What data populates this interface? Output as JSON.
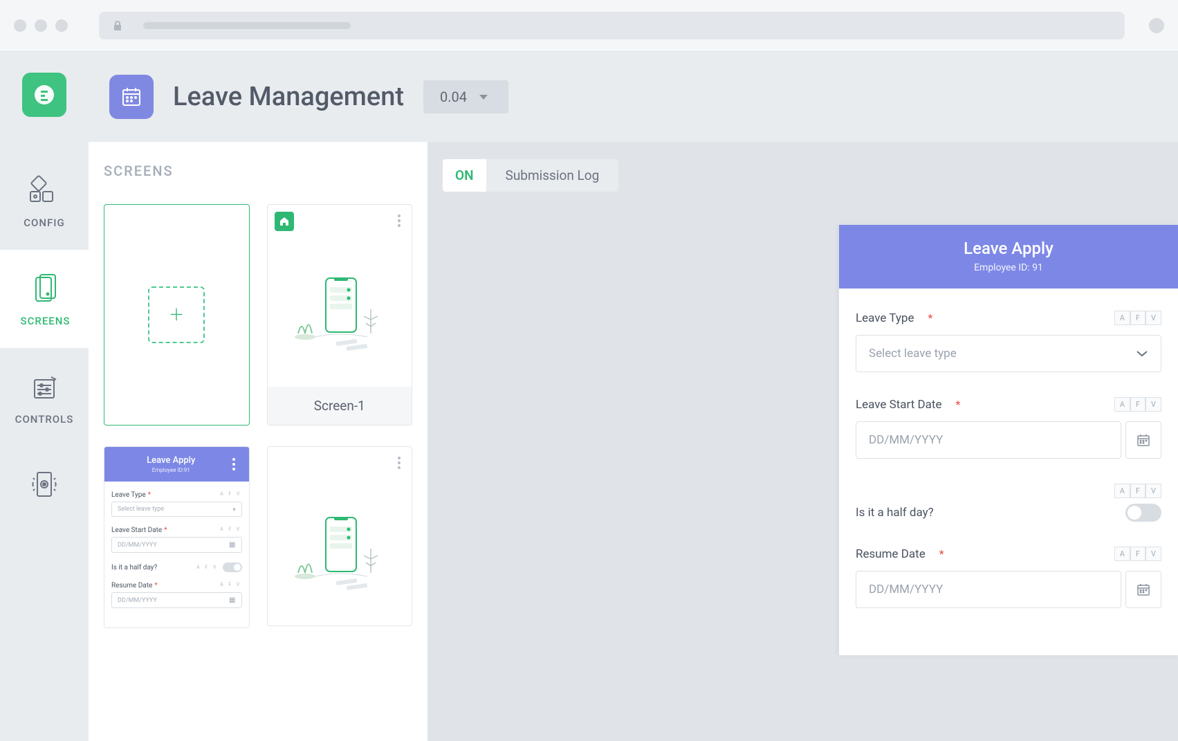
{
  "header": {
    "app_title": "Leave Management",
    "version": "0.04"
  },
  "sidebar": {
    "items": [
      {
        "label": "CONFIG"
      },
      {
        "label": "SCREENS"
      },
      {
        "label": "CONTROLS"
      }
    ]
  },
  "screens_panel": {
    "heading": "SCREENS",
    "cards": [
      {
        "type": "add"
      },
      {
        "type": "home",
        "label": "Screen-1"
      },
      {
        "type": "preview"
      },
      {
        "type": "normal"
      }
    ]
  },
  "canvas": {
    "toggle_on": "ON",
    "toggle_log": "Submission Log"
  },
  "form": {
    "title": "Leave Apply",
    "subtitle": "Employee ID: 91",
    "fields": {
      "leave_type": {
        "label": "Leave Type",
        "placeholder": "Select leave type"
      },
      "start_date": {
        "label": "Leave Start Date",
        "placeholder": "DD/MM/YYYY"
      },
      "half_day": {
        "label": "Is it a half day?"
      },
      "resume_date": {
        "label": "Resume Date",
        "placeholder": "DD/MM/YYYY"
      }
    },
    "afv": [
      "A",
      "F",
      "V"
    ]
  },
  "preview_card": {
    "title": "Leave Apply",
    "subtitle": "Employee ID:91",
    "fields": {
      "leave_type": {
        "label": "Leave Type",
        "placeholder": "Select leave type"
      },
      "start_date": {
        "label": "Leave Start Date",
        "placeholder": "DD/MM/YYYY"
      },
      "half_day": {
        "label": "Is it a half day?"
      },
      "resume_date": {
        "label": "Resume Date",
        "placeholder": "DD/MM/YYYY"
      }
    }
  }
}
